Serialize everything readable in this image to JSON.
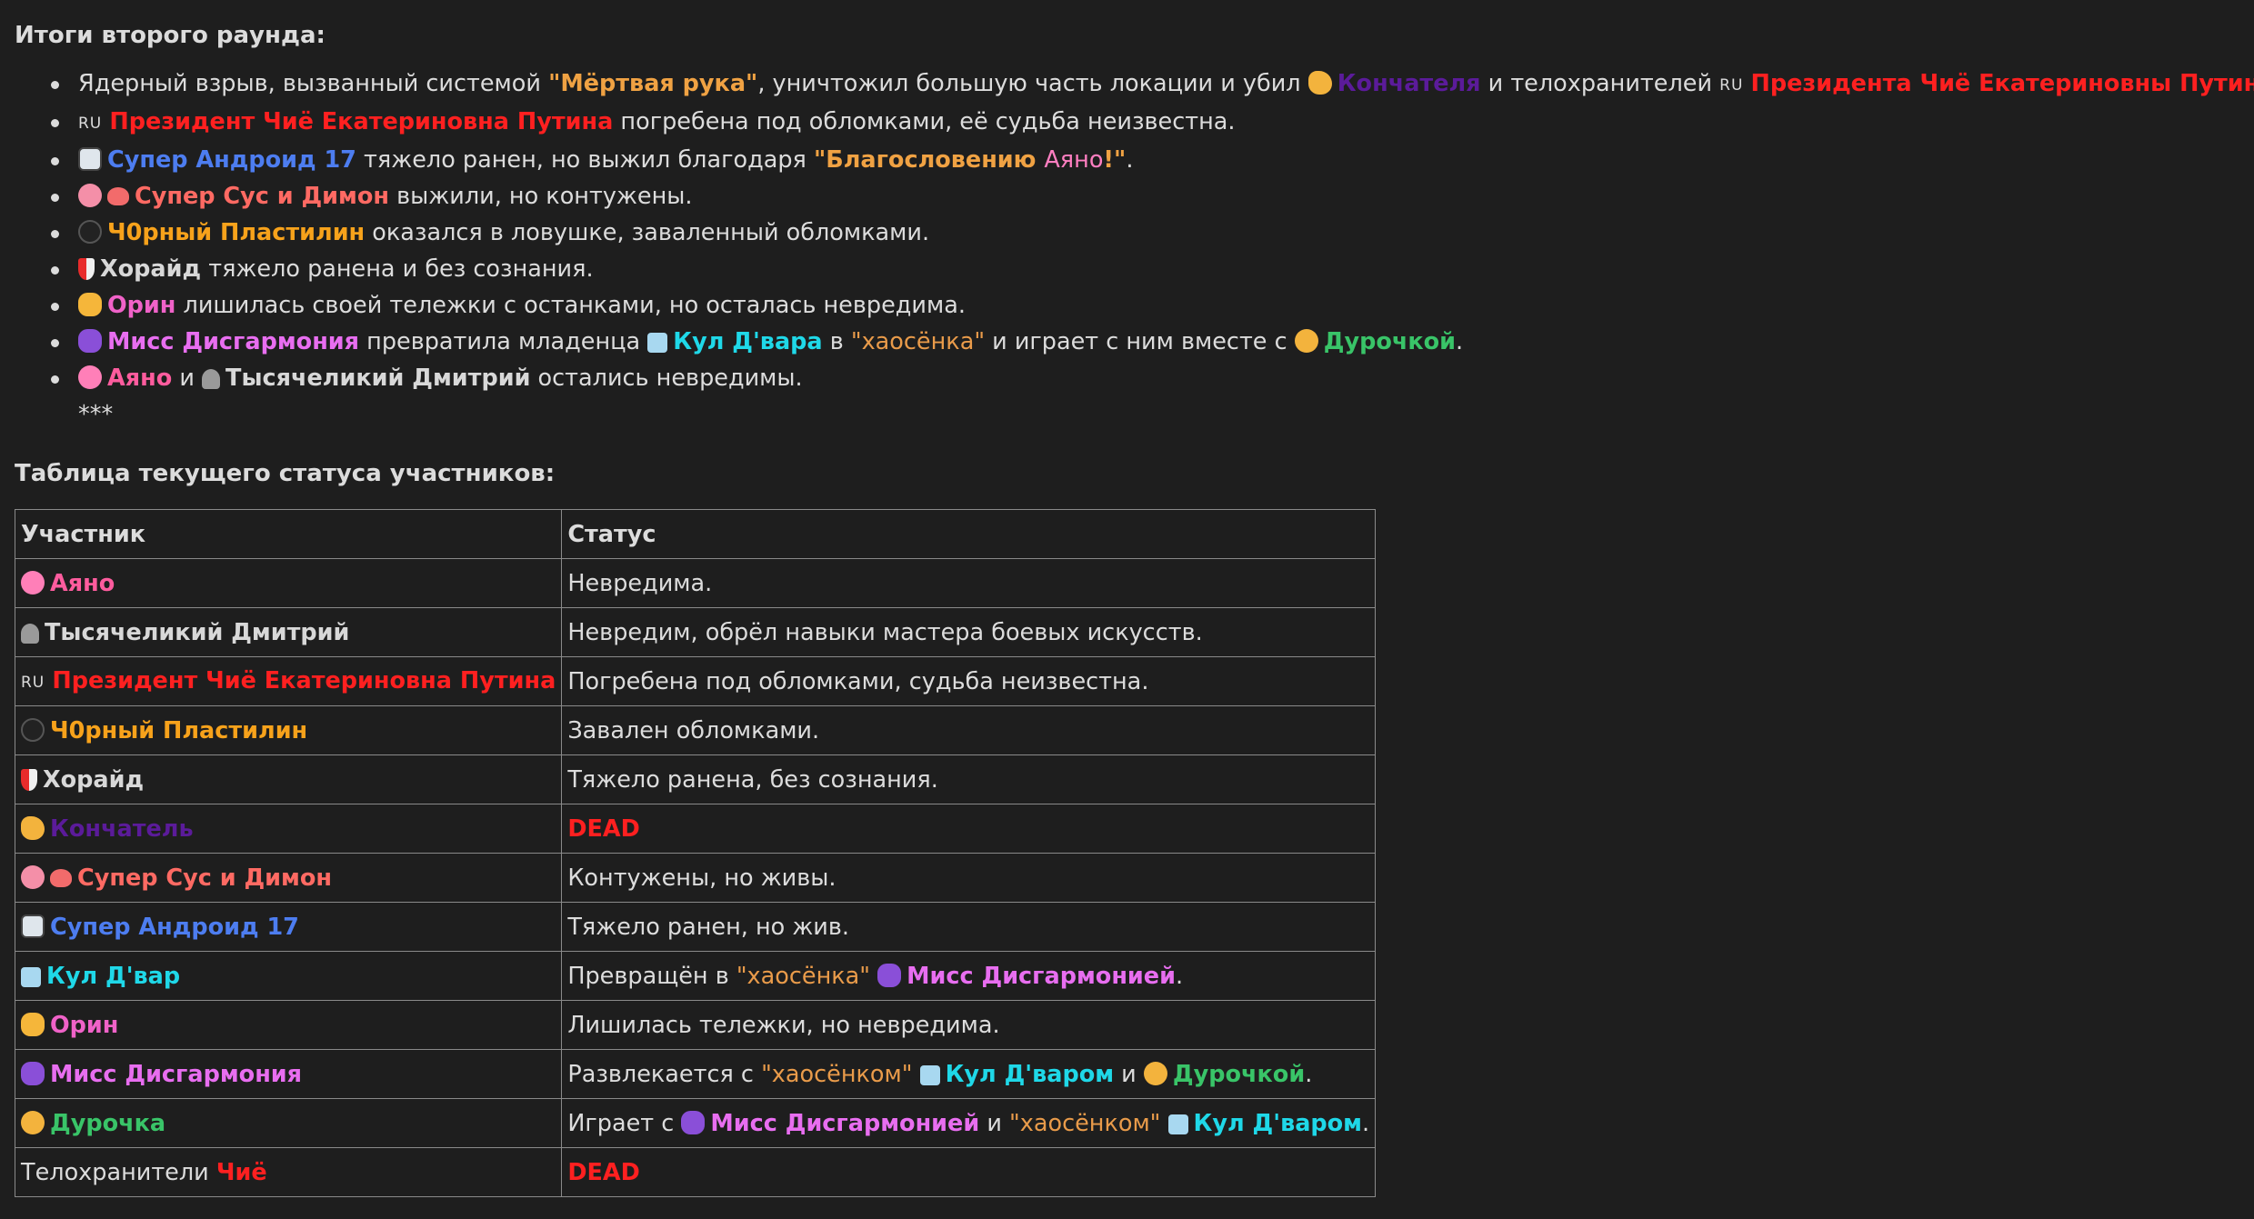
{
  "round_title": "Итоги второго раунда:",
  "list": {
    "l1": {
      "a": "Ядерный взрыв, вызванный системой ",
      "q": "\"Мёртвая рука\"",
      "b": ", уничтожил большую часть локации и убил ",
      "konch": "Кончателя",
      "c": " и телохранителей ",
      "ru": "RU",
      "pres": "Президента Чиё Екатериновны Путины",
      "d": "."
    },
    "l2": {
      "ru": "RU",
      "pres": "Президент Чиё Екатериновна Путина",
      "a": " погребена под обломками, её судьба неизвестна."
    },
    "l3": {
      "name": "Супер Андроид 17",
      "a": " тяжело ранен, но выжил благодаря ",
      "q": "\"Благословению ",
      "ayano": "Аяно",
      "q2": "!\"",
      "b": "."
    },
    "l4": {
      "name": "Супер Сус и Димон",
      "a": " выжили, но контужены."
    },
    "l5": {
      "name": "Ч0рный Пластилин",
      "a": " оказался в ловушке, заваленный обломками."
    },
    "l6": {
      "name": "Хорайд",
      "a": " тяжело ранена и без сознания."
    },
    "l7": {
      "name": "Орин",
      "a": " лишилась своей тележки с останками, но осталась невредима."
    },
    "l8": {
      "name": "Мисс Дисгармония",
      "a": " превратила младенца ",
      "kul": "Кул Д'вара",
      "b": " в ",
      "q": "\"хаосёнка\"",
      "c": " и играет с ним вместе с ",
      "dur": "Дурочкой",
      "d": "."
    },
    "l9": {
      "ayano": "Аяно",
      "a": " и ",
      "dmitry": "Тысячеликий Дмитрий",
      "b": " остались невредимы."
    }
  },
  "stars": "***",
  "table_title": "Таблица текущего статуса участников:",
  "table": {
    "h1": "Участник",
    "h2": "Статус",
    "r1": {
      "name": "Аяно",
      "status": "Невредима."
    },
    "r2": {
      "name": "Тысячеликий Дмитрий",
      "status": "Невредим, обрёл навыки мастера боевых искусств."
    },
    "r3": {
      "ru": "RU",
      "name": "Президент Чиё Екатериновна Путина",
      "status": "Погребена под обломками, судьба неизвестна."
    },
    "r4": {
      "name": "Ч0рный Пластилин",
      "status": "Завален обломками."
    },
    "r5": {
      "name": "Хорайд",
      "status": "Тяжело ранена, без сознания."
    },
    "r6": {
      "name": "Кончатель",
      "status": "DEAD"
    },
    "r7": {
      "name": "Супер Сус и Димон",
      "status": "Контужены, но живы."
    },
    "r8": {
      "name": "Супер Андроид 17",
      "status": "Тяжело ранен, но жив."
    },
    "r9": {
      "name": "Кул Д'вар",
      "a": "Превращён в ",
      "q": "\"хаосёнка\"",
      "b": " ",
      "who": "Мисс Дисгармонией",
      "c": "."
    },
    "r10": {
      "name": "Орин",
      "status": "Лишилась тележки, но невредима."
    },
    "r11": {
      "name": "Мисс Дисгармония",
      "a": "Развлекается с ",
      "q": "\"хаосёнком\"",
      "b": " ",
      "kul": "Кул Д'варом",
      "c": " и ",
      "dur": "Дурочкой",
      "d": "."
    },
    "r12": {
      "name": "Дурочка",
      "a": "Играет с ",
      "miss": "Мисс Дисгармонией",
      "b": " и ",
      "q": "\"хаосёнком\"",
      "c": " ",
      "kul": "Кул Д'варом",
      "d": "."
    },
    "r13": {
      "a": "Телохранители ",
      "name": "Чиё",
      "status": "DEAD"
    }
  }
}
